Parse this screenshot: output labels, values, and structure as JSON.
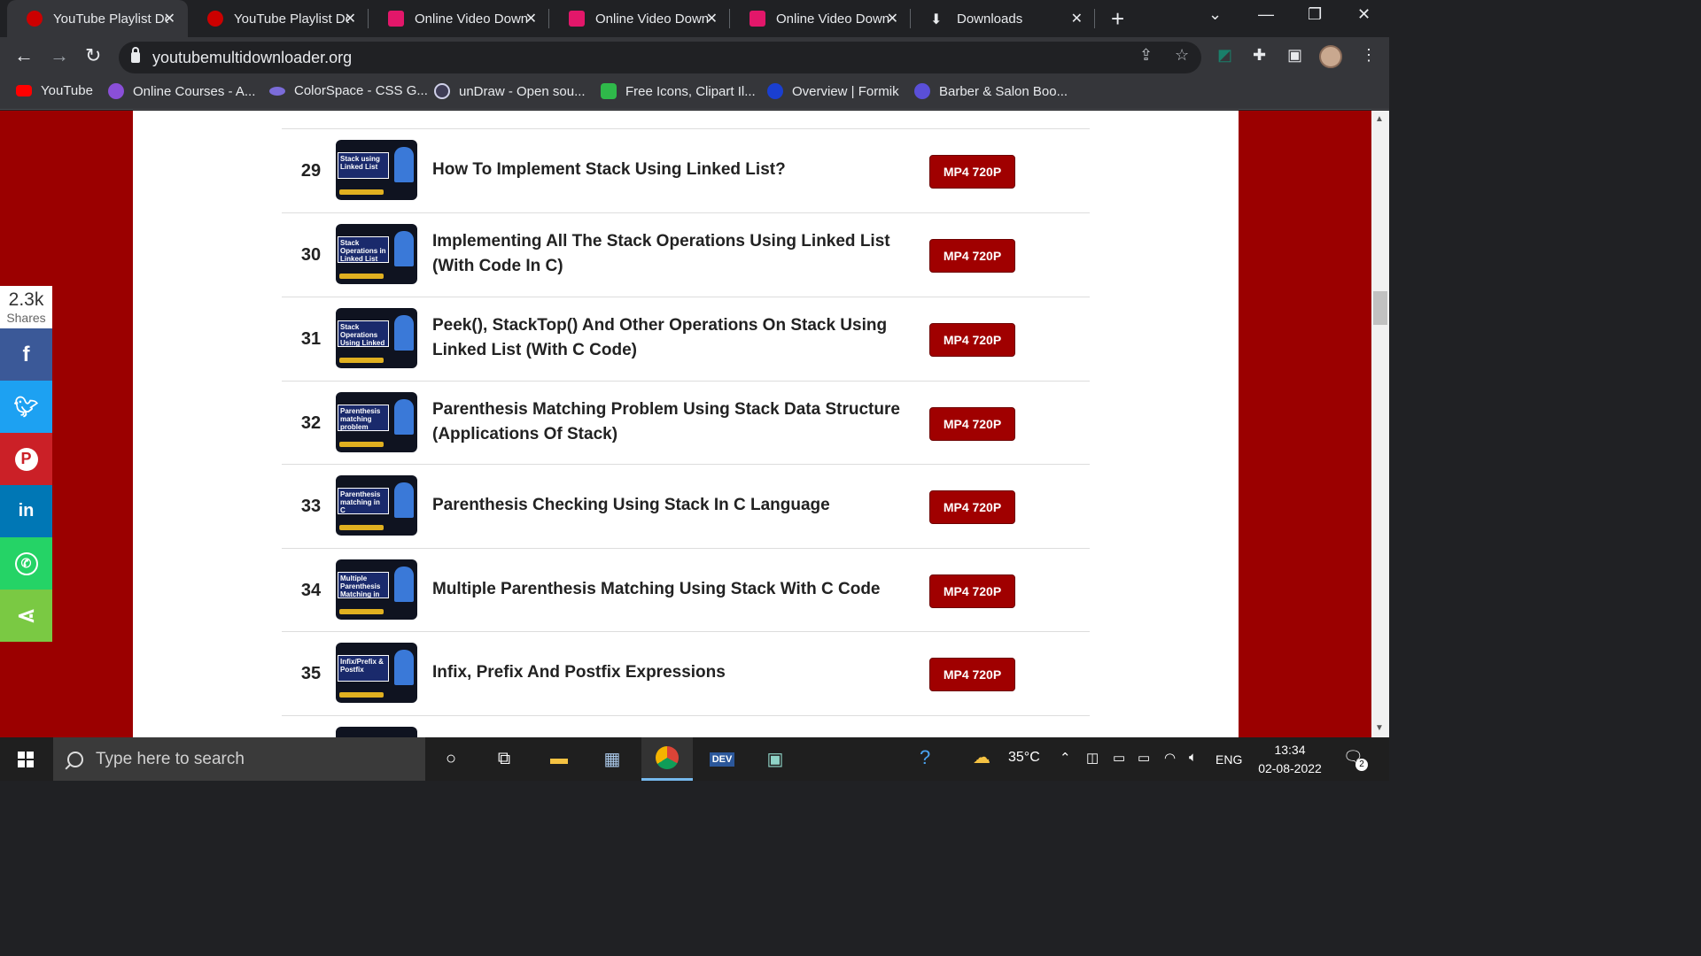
{
  "browser": {
    "tabs": [
      {
        "label": "YouTube Playlist Do",
        "favicon_color": "#cc0000",
        "active": true
      },
      {
        "label": "YouTube Playlist Do",
        "favicon_color": "#cc0000",
        "active": false
      },
      {
        "label": "Online Video Down",
        "favicon_color": "#e2176a",
        "active": false
      },
      {
        "label": "Online Video Down",
        "favicon_color": "#e2176a",
        "active": false
      },
      {
        "label": "Online Video Down",
        "favicon_color": "#e2176a",
        "active": false
      },
      {
        "label": "Downloads",
        "favicon_color": "#e8eaed",
        "active": false
      }
    ],
    "url": "youtubemultidownloader.org",
    "bookmarks": [
      {
        "label": "YouTube",
        "icon_color": "#ff0000"
      },
      {
        "label": "Online Courses - A...",
        "icon_color": "#8a4fd8"
      },
      {
        "label": "ColorSpace - CSS G...",
        "icon_color": "#7b6cd9"
      },
      {
        "label": "unDraw - Open sou...",
        "icon_color": "#3f3d56"
      },
      {
        "label": "Free Icons, Clipart Il...",
        "icon_color": "#2fb94a"
      },
      {
        "label": "Overview | Formik",
        "icon_color": "#1a3fd0"
      },
      {
        "label": "Barber & Salon Boo...",
        "icon_color": "#5a4fd8"
      }
    ]
  },
  "share_bar": {
    "count": "2.3k",
    "label": "Shares",
    "buttons": [
      {
        "name": "facebook",
        "glyph": "f",
        "color": "#3b5998"
      },
      {
        "name": "twitter",
        "glyph": "t",
        "color": "#1da1f2"
      },
      {
        "name": "pinterest",
        "glyph": "P",
        "color": "#cb2027"
      },
      {
        "name": "linkedin",
        "glyph": "in",
        "color": "#0077b5"
      },
      {
        "name": "whatsapp",
        "glyph": "✆",
        "color": "#25d366"
      },
      {
        "name": "share",
        "glyph": "⋖",
        "color": "#7ac943"
      }
    ]
  },
  "videos": [
    {
      "num": "29",
      "title": "How To Implement Stack Using Linked List?",
      "thumb_text": "Stack using Linked List",
      "button": "MP4 720P"
    },
    {
      "num": "30",
      "title": "Implementing All The Stack Operations Using Linked List (With Code In C)",
      "thumb_text": "Stack Operations in Linked List",
      "button": "MP4 720P"
    },
    {
      "num": "31",
      "title": "Peek(), StackTop() And Other Operations On Stack Using Linked List (With C Code)",
      "thumb_text": "Stack Operations Using Linked List",
      "button": "MP4 720P"
    },
    {
      "num": "32",
      "title": "Parenthesis Matching Problem Using Stack Data Structure (Applications Of Stack)",
      "thumb_text": "Parenthesis matching problem",
      "button": "MP4 720P"
    },
    {
      "num": "33",
      "title": "Parenthesis Checking Using Stack In C Language",
      "thumb_text": "Parenthesis matching in C",
      "button": "MP4 720P"
    },
    {
      "num": "34",
      "title": "Multiple Parenthesis Matching Using Stack With C Code",
      "thumb_text": "Multiple Parenthesis Matching in C",
      "button": "MP4 720P"
    },
    {
      "num": "35",
      "title": "Infix, Prefix And Postfix Expressions",
      "thumb_text": "Infix/Prefix & Postfix",
      "button": "MP4 720P"
    }
  ],
  "taskbar": {
    "search_placeholder": "Type here to search",
    "temperature": "35°C",
    "language": "ENG",
    "time": "13:34",
    "date": "02-08-2022",
    "notification_count": "2"
  }
}
